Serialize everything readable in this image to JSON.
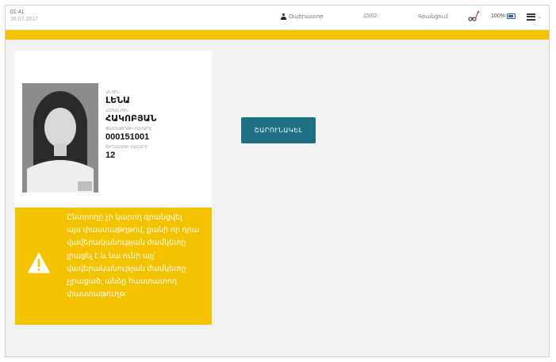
{
  "status_bar": {
    "time": "01:41",
    "date": "26.07.2017",
    "user_label": "Օպերատոր",
    "counter": "15/02",
    "status_text": "Գրանցում",
    "battery": "100%"
  },
  "id_card": {
    "fields": [
      {
        "label": "ԱՆՈՒՆ",
        "value": "ԼԵՆԱ"
      },
      {
        "label": "ԱԶԳԱՆՈՒՆ",
        "value": "ՀԱԿՈԲՅԱՆ"
      },
      {
        "label": "ՓԱՍՏԱԹՂԹԻ ՀԱՄԱՐԸ",
        "value": "000151001"
      },
      {
        "label": "ՏԵՂԱՄԱՍԻ ՀԱՄԱՐԸ",
        "value": "12"
      }
    ]
  },
  "warning": {
    "icon": "warning-triangle-icon",
    "lines": [
      "Ընտրողը չի կարող գրանցվել",
      "այս փաստաթղթով, քանի որ դրա",
      "վավերականության ժամկետը",
      "լրացել է և նա ունի այլ՝",
      "վավերականության ժամկետը",
      "չլրացած, անձը հաստատող",
      "փաստաթուղթ:"
    ]
  },
  "actions": {
    "continue_label": "ՇԱՐՈՒՆԱԿԵԼ"
  },
  "colors": {
    "accent_yellow": "#f5c200",
    "button_teal": "#1e6f84",
    "battery_blue": "#1a5fb4"
  }
}
